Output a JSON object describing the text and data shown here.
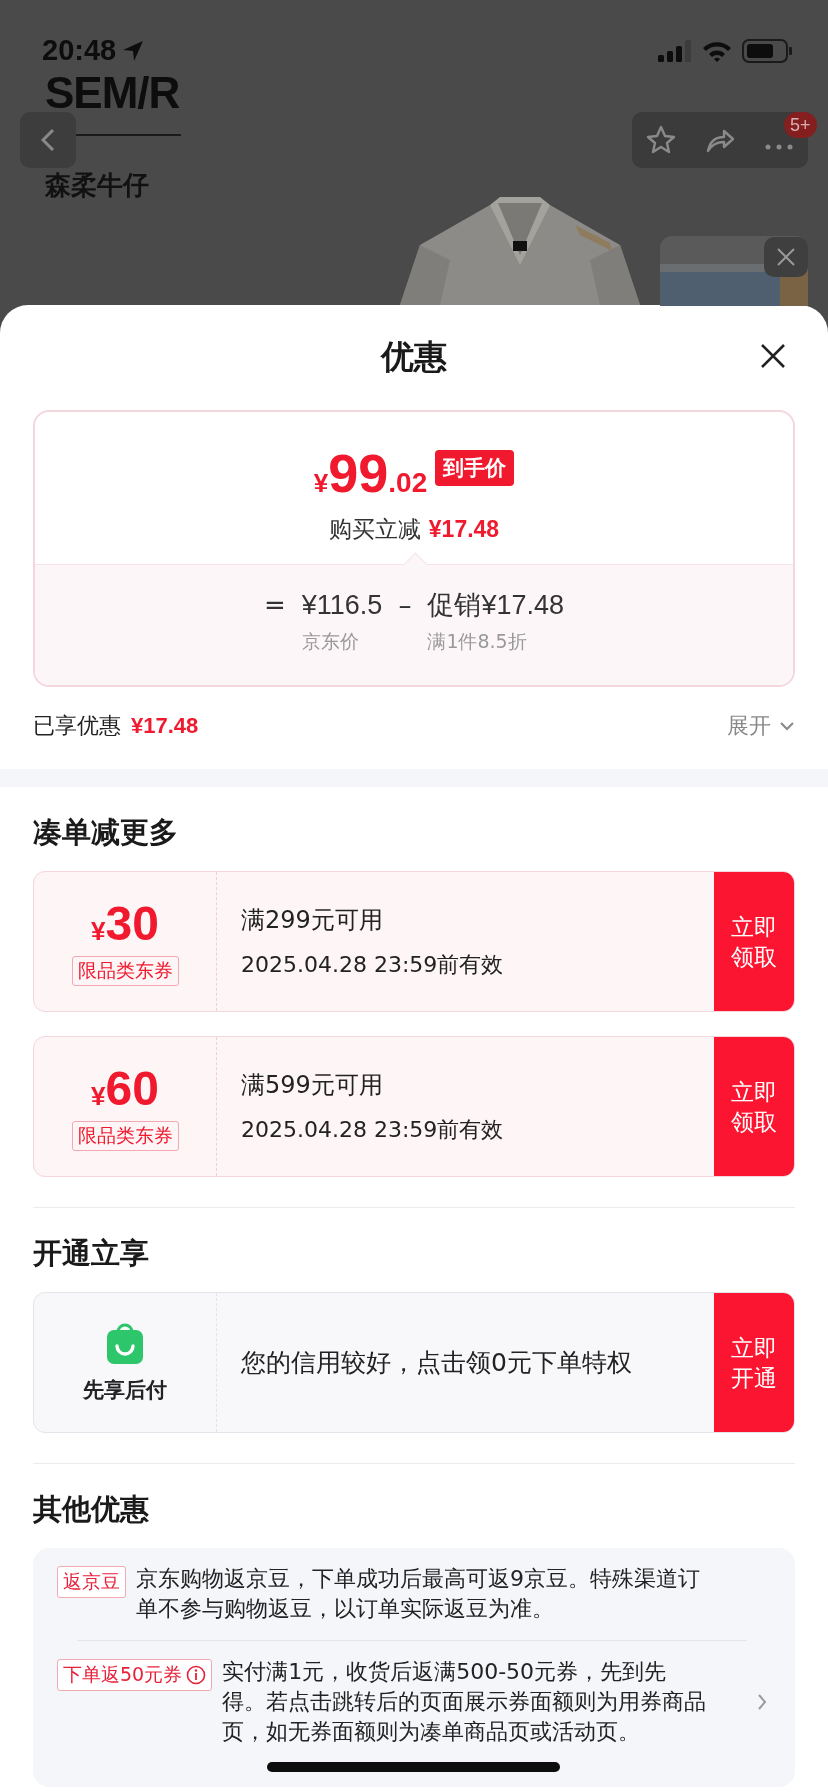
{
  "status_bar": {
    "time": "20:48"
  },
  "header": {
    "brand_logo": "SEM/R",
    "shop_name": "森柔牛仔",
    "more_badge": "5+"
  },
  "sheet": {
    "title": "优惠",
    "price_card": {
      "currency": "¥",
      "price_integer": "99",
      "price_decimal": ".02",
      "price_tag": "到手价",
      "saving_label": "购买立减",
      "saving_value": "¥17.48",
      "equals": "=",
      "base_price": "¥116.5",
      "base_label": "京东价",
      "minus": "–",
      "promo": "促销¥17.48",
      "promo_label": "满1件8.5折"
    },
    "enjoyed": {
      "label": "已享优惠",
      "value": "¥17.48",
      "toggle": "展开",
      "expanded": false
    },
    "coupon_section": {
      "title": "凑单减更多",
      "coupons": [
        {
          "currency": "¥",
          "amount": "30",
          "tag": "限品类东券",
          "condition": "满299元可用",
          "validity": "2025.04.28 23:59前有效",
          "button": "立即领取"
        },
        {
          "currency": "¥",
          "amount": "60",
          "tag": "限品类东券",
          "condition": "满599元可用",
          "validity": "2025.04.28 23:59前有效",
          "button": "立即领取"
        }
      ]
    },
    "pay_later_section": {
      "title": "开通立享",
      "card": {
        "name": "先享后付",
        "text": "您的信用较好，点击领0元下单特权",
        "button": "立即开通"
      }
    },
    "other_section": {
      "title": "其他优惠",
      "items": [
        {
          "tag": "返京豆",
          "info": false,
          "link": false,
          "text": "京东购物返京豆，下单成功后最高可返9京豆。特殊渠道订单不参与购物返豆，以订单实际返豆为准。"
        },
        {
          "tag": "下单返50元券",
          "info": true,
          "link": true,
          "text": "实付满1元，收货后返满500-50元券，先到先得。若点击跳转后的页面展示券面额则为用券商品页，如无券面额则为凑单商品页或活动页。"
        }
      ]
    }
  }
}
